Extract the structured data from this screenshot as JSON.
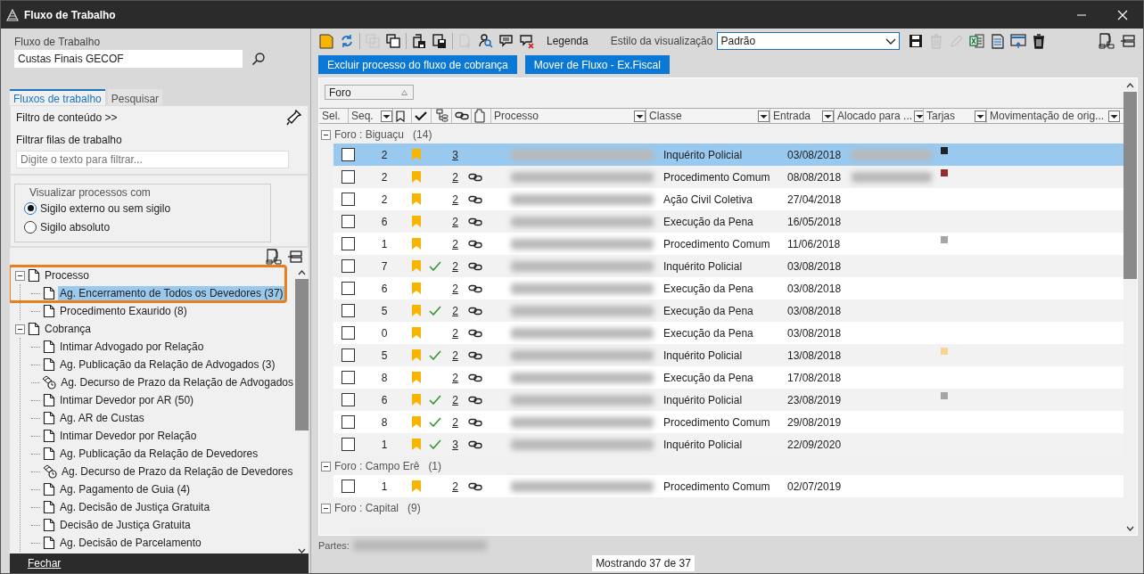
{
  "window": {
    "title": "Fluxo de Trabalho"
  },
  "workflow": {
    "label": "Fluxo de Trabalho",
    "value": "Custas Finais GECOF"
  },
  "tabs": [
    {
      "label": "Fluxos de trabalho",
      "selected": true
    },
    {
      "label": "Pesquisar",
      "selected": false
    }
  ],
  "filter": {
    "title": "Filtro de conteúdo >>",
    "label": "Filtrar filas de trabalho",
    "placeholder": "Digite o texto para filtrar..."
  },
  "visibility": {
    "legend": "Visualizar processos com",
    "options": [
      {
        "label": "Sigilo externo ou sem sigilo",
        "selected": true
      },
      {
        "label": "Sigilo absoluto",
        "selected": false
      }
    ]
  },
  "tree": [
    {
      "label": "Processo",
      "expanded": true,
      "selected": false,
      "children": [
        {
          "label": "Ag. Encerramento de Todos os Devedores (37)",
          "kind": "document",
          "selected": true
        },
        {
          "label": "Procedimento Exaurido (8)",
          "kind": "document",
          "selected": false
        }
      ]
    },
    {
      "label": "Cobrança",
      "expanded": true,
      "selected": false,
      "children": [
        {
          "label": "Intimar Advogado por Relação",
          "kind": "document",
          "selected": false
        },
        {
          "label": "Ag. Publicação da Relação de Advogados (3)",
          "kind": "document",
          "selected": false
        },
        {
          "label": "Ag. Decurso de Prazo da Relação de Advogados",
          "kind": "timer",
          "selected": false
        },
        {
          "label": "Intimar Devedor por AR (50)",
          "kind": "document",
          "selected": false
        },
        {
          "label": "Ag. AR de Custas",
          "kind": "document",
          "selected": false
        },
        {
          "label": "Intimar Devedor por Relação",
          "kind": "document",
          "selected": false
        },
        {
          "label": "Ag. Publicação da Relação de Devedores",
          "kind": "document",
          "selected": false
        },
        {
          "label": "Ag. Decurso de Prazo da Relação de Devedores",
          "kind": "timer",
          "selected": false
        },
        {
          "label": "Ag. Pagamento de Guia (4)",
          "kind": "document",
          "selected": false
        },
        {
          "label": "Ag. Decisão de Justiça Gratuita",
          "kind": "document",
          "selected": false
        },
        {
          "label": "Decisão de Justiça Gratuita",
          "kind": "document",
          "selected": false
        },
        {
          "label": "Ag. Decisão de Parcelamento",
          "kind": "document",
          "selected": false
        }
      ]
    }
  ],
  "close_button": "Fechar",
  "toolbar": [
    {
      "kind": "note",
      "disabled": false
    },
    {
      "kind": "refresh",
      "disabled": false
    },
    {
      "kind": "copy-check",
      "disabled": true
    },
    {
      "kind": "copy",
      "disabled": false
    },
    {
      "kind": "save-copy",
      "disabled": false
    },
    {
      "kind": "save-doc",
      "disabled": false
    },
    {
      "kind": "export-doc",
      "disabled": true
    },
    {
      "kind": "person-search",
      "disabled": false
    },
    {
      "kind": "comment",
      "disabled": false
    },
    {
      "kind": "comment-remove",
      "disabled": false
    }
  ],
  "legend_button": "Legenda",
  "view_style": {
    "label": "Estilo da visualização",
    "value": "Padrão"
  },
  "view_tools": [
    {
      "kind": "save",
      "disabled": false
    },
    {
      "kind": "trash",
      "disabled": true
    },
    {
      "kind": "pencil",
      "disabled": true
    },
    {
      "kind": "excel",
      "disabled": false
    },
    {
      "kind": "document",
      "disabled": false
    },
    {
      "kind": "window-export",
      "disabled": false
    },
    {
      "kind": "trash",
      "disabled": false
    }
  ],
  "actions": [
    "Excluir processo do fluxo de cobrança",
    "Mover de Fluxo - Ex.Fiscal"
  ],
  "group_by": "Foro",
  "columns": [
    {
      "kind": "text",
      "label": "Sel.",
      "filter": false
    },
    {
      "kind": "text",
      "label": "Seq.",
      "filter": true
    },
    {
      "kind": "bookmark"
    },
    {
      "kind": "check"
    },
    {
      "kind": "tree"
    },
    {
      "kind": "link"
    },
    {
      "kind": "doc"
    },
    {
      "kind": "text",
      "label": "Processo",
      "filter": true
    },
    {
      "kind": "text",
      "label": "Classe",
      "filter": true
    },
    {
      "kind": "text",
      "label": "Entrada",
      "filter": true
    },
    {
      "kind": "text",
      "label": "Alocado para ...",
      "filter": true
    },
    {
      "kind": "text",
      "label": "Tarjas",
      "filter": true
    },
    {
      "kind": "text",
      "label": "Movimentação de orig...",
      "filter": true
    }
  ],
  "groups": [
    {
      "label": "Foro : Biguaçu",
      "count": "(14)",
      "expanded": true,
      "rows": [
        {
          "checked": false,
          "seq": "2",
          "verified": false,
          "count": "3",
          "linked": false,
          "classe": "Inquérito Policial",
          "entrada": "03/08/2018",
          "alocado_blurred": true,
          "color": "#222222",
          "selected": true
        },
        {
          "checked": false,
          "seq": "2",
          "verified": false,
          "count": "2",
          "linked": true,
          "classe": "Procedimento Comum",
          "entrada": "08/08/2018",
          "alocado_blurred": true,
          "color": "#9b2a2a",
          "selected": false
        },
        {
          "checked": false,
          "seq": "2",
          "verified": false,
          "count": "2",
          "linked": true,
          "classe": "Ação Civil Coletiva",
          "entrada": "27/04/2018",
          "alocado_blurred": false,
          "selected": false
        },
        {
          "checked": false,
          "seq": "6",
          "verified": false,
          "count": "2",
          "linked": true,
          "classe": "Execução da Pena",
          "entrada": "16/05/2018",
          "alocado_blurred": false,
          "selected": false
        },
        {
          "checked": false,
          "seq": "1",
          "verified": false,
          "count": "2",
          "linked": true,
          "classe": "Procedimento Comum",
          "entrada": "11/06/2018",
          "alocado_blurred": false,
          "color": "#a6a6a6",
          "selected": false
        },
        {
          "checked": false,
          "seq": "7",
          "verified": true,
          "count": "2",
          "linked": true,
          "classe": "Inquérito Policial",
          "entrada": "03/08/2018",
          "alocado_blurred": false,
          "selected": false
        },
        {
          "checked": false,
          "seq": "6",
          "verified": false,
          "count": "2",
          "linked": true,
          "classe": "Execução da Pena",
          "entrada": "03/08/2018",
          "alocado_blurred": false,
          "selected": false
        },
        {
          "checked": false,
          "seq": "5",
          "verified": true,
          "count": "2",
          "linked": true,
          "classe": "Execução da Pena",
          "entrada": "03/08/2018",
          "alocado_blurred": false,
          "selected": false
        },
        {
          "checked": false,
          "seq": "0",
          "verified": false,
          "count": "2",
          "linked": true,
          "classe": "Execução da Pena",
          "entrada": "03/08/2018",
          "alocado_blurred": false,
          "selected": false
        },
        {
          "checked": false,
          "seq": "5",
          "verified": true,
          "count": "2",
          "linked": true,
          "classe": "Inquérito Policial",
          "entrada": "13/08/2018",
          "alocado_blurred": false,
          "color": "#f7d58c",
          "selected": false
        },
        {
          "checked": false,
          "seq": "8",
          "verified": false,
          "count": "2",
          "linked": true,
          "classe": "Execução da Pena",
          "entrada": "17/08/2018",
          "alocado_blurred": false,
          "selected": false
        },
        {
          "checked": false,
          "seq": "6",
          "verified": true,
          "count": "2",
          "linked": true,
          "classe": "Inquérito Policial",
          "entrada": "23/08/2019",
          "alocado_blurred": false,
          "color": "#a6a6a6",
          "selected": false
        },
        {
          "checked": false,
          "seq": "8",
          "verified": true,
          "count": "2",
          "linked": true,
          "classe": "Procedimento Comum",
          "entrada": "29/08/2019",
          "alocado_blurred": false,
          "selected": false
        },
        {
          "checked": false,
          "seq": "1",
          "verified": true,
          "count": "3",
          "linked": true,
          "classe": "Inquérito Policial",
          "entrada": "22/09/2020",
          "alocado_blurred": false,
          "selected": false
        }
      ]
    },
    {
      "label": "Foro : Campo Erê",
      "count": "(1)",
      "expanded": true,
      "rows": [
        {
          "checked": false,
          "seq": "1",
          "verified": false,
          "count": "2",
          "linked": true,
          "classe": "Procedimento Comum",
          "entrada": "02/07/2019",
          "alocado_blurred": false,
          "selected": false
        }
      ]
    },
    {
      "label": "Foro : Capital",
      "count": "(9)",
      "expanded": true
    }
  ],
  "parts_label": "Partes:",
  "status": "Mostrando 37 de 37"
}
